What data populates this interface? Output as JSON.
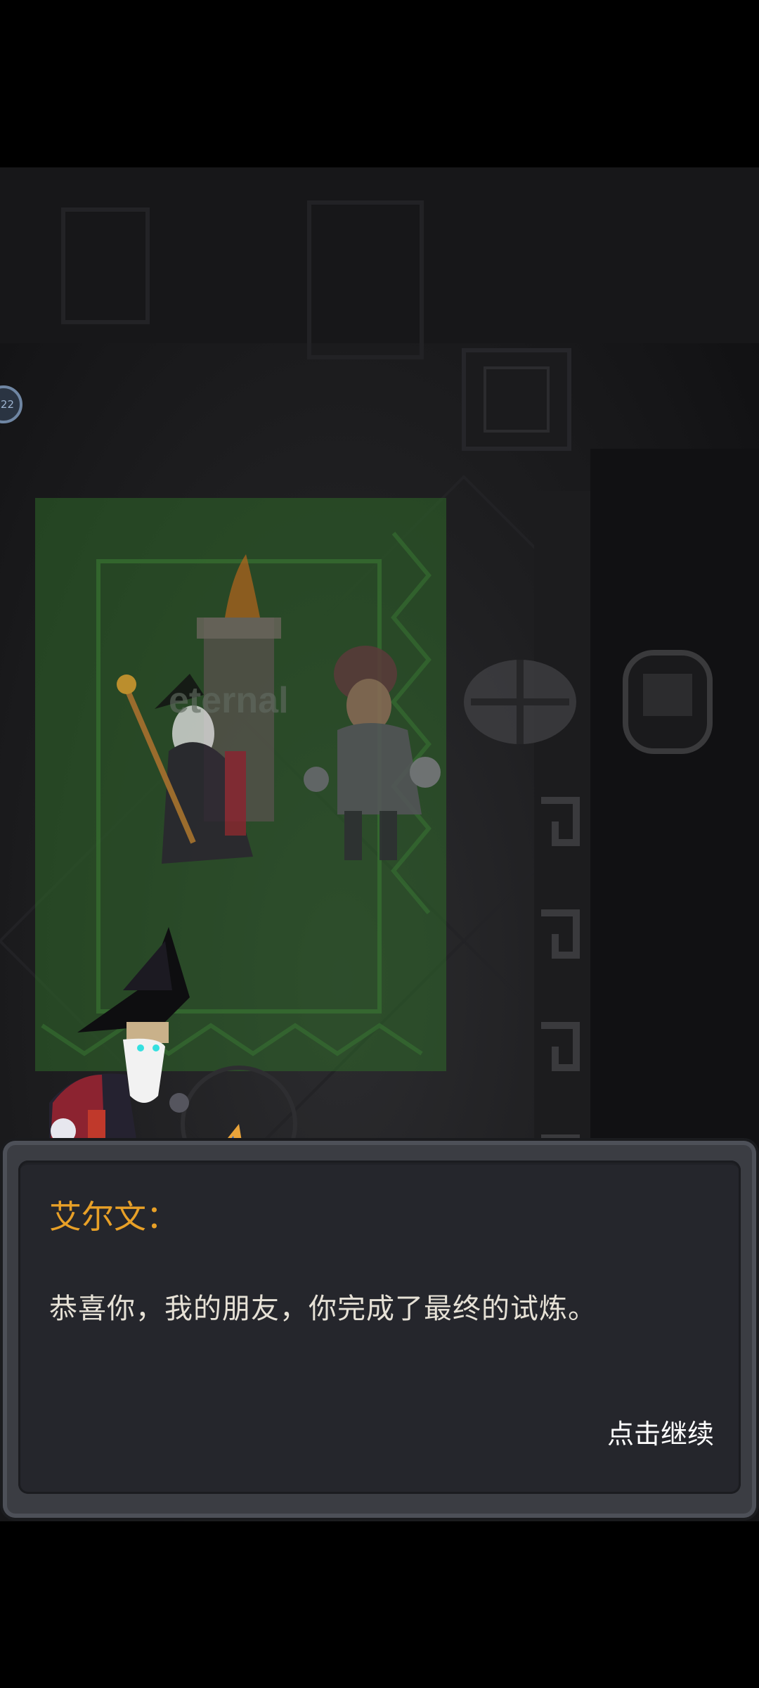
{
  "hud": {
    "level_badge": "22"
  },
  "banner": {
    "text": "eternal"
  },
  "dialog": {
    "speaker": "艾尔文：",
    "message": "恭喜你，我的朋友，你完成了最终的试炼。",
    "continue_label": "点击继续"
  },
  "colors": {
    "speaker": "#e8a027",
    "message": "#e6e1d6",
    "banner_green": "#2f6a2a"
  }
}
